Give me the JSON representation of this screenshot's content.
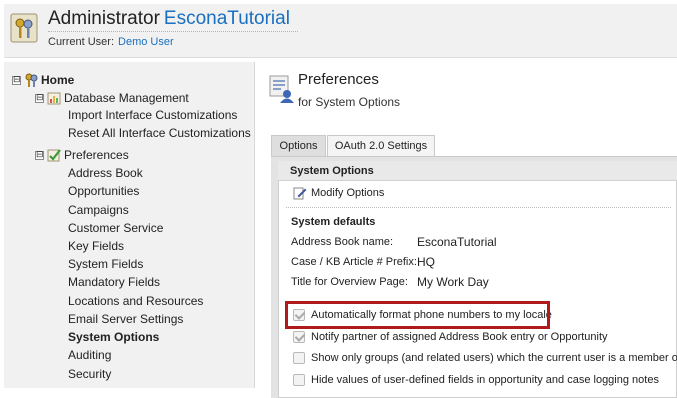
{
  "header": {
    "title": "Administrator",
    "org": "EsconaTutorial",
    "current_user_label": "Current User:",
    "current_user": "Demo User"
  },
  "sidebar": {
    "home": {
      "label": "Home",
      "toggle": "⊟"
    },
    "database": {
      "label": "Database Management",
      "toggle": "⊟",
      "items": [
        "Import Interface Customizations",
        "Reset All Interface Customizations"
      ]
    },
    "preferences": {
      "label": "Preferences",
      "toggle": "⊟",
      "items": [
        "Address Book",
        "Opportunities",
        "Campaigns",
        "Customer Service",
        "Key Fields",
        "System Fields",
        "Mandatory Fields",
        "Locations and Resources",
        "Email Server Settings",
        "System Options",
        "Auditing",
        "Security"
      ],
      "active_item": "System Options"
    }
  },
  "main": {
    "title": "Preferences",
    "subtitle": "for System Options",
    "tabs": [
      {
        "label": "Options"
      },
      {
        "label": "OAuth 2.0 Settings"
      }
    ],
    "section_title": "System Options",
    "modify_label": "Modify Options",
    "defaults_title": "System defaults",
    "defaults": [
      {
        "label": "Address Book name:",
        "value": "EsconaTutorial"
      },
      {
        "label": "Case / KB Article # Prefix:",
        "value": "HQ"
      },
      {
        "label": "Title for Overview Page:",
        "value": "My Work Day"
      }
    ],
    "checkboxes": [
      {
        "label": "Automatically format phone numbers to my locale",
        "checked": true
      },
      {
        "label": "Notify partner of assigned Address Book entry or Opportunity",
        "checked": true
      },
      {
        "label": "Show only groups (and related users) which the current user is a member of",
        "checked": false
      },
      {
        "label": "Hide values of user-defined fields in opportunity and case logging notes",
        "checked": false
      }
    ]
  },
  "colors": {
    "link": "#1a6fbf",
    "highlight": "#b11a1a",
    "panel_bg": "#f1f1f1"
  }
}
